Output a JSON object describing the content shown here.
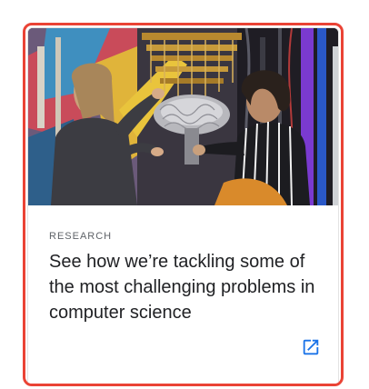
{
  "card": {
    "image_alt": "Two researchers examining a quantum computer cryostat",
    "eyebrow": "RESEARCH",
    "headline": "See how we’re tackling some of the most challenging problems in computer science",
    "link_icon": "open-in-new-icon"
  },
  "colors": {
    "focus_ring": "#ea4335",
    "link_icon": "#1a73e8",
    "eyebrow_text": "#5f6368",
    "headline_text": "#202124"
  }
}
